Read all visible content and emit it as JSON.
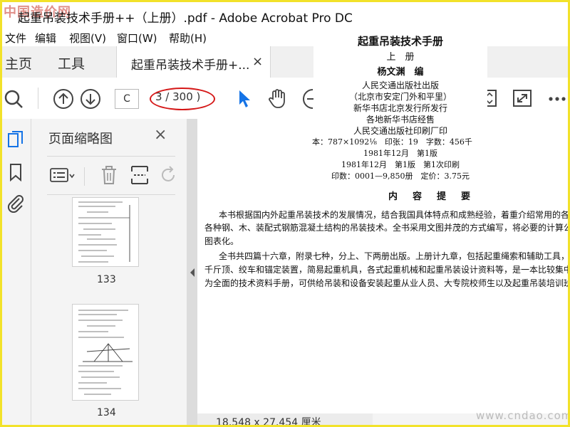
{
  "window": {
    "title": "起重吊装技术手册++（上册）.pdf - Adobe Acrobat Pro DC",
    "watermark_top": "中国造价网",
    "watermark_bottom": "www.cndao.com"
  },
  "menu": [
    "文件",
    "编辑",
    "视图(V)",
    "窗口(W)",
    "帮助(H)"
  ],
  "tabs": {
    "home": "主页",
    "tools": "工具",
    "document": "起重吊装技术手册+...",
    "close": "×"
  },
  "toolbar": {
    "page_input": "C",
    "page_count": "3 / 300 )"
  },
  "panel": {
    "title": "页面缩略图",
    "close": "×",
    "thumbnails": [
      {
        "number": "133"
      },
      {
        "number": "134"
      }
    ]
  },
  "document": {
    "header_lines": [
      "起重吊装技术手册",
      "上　册",
      "杨文渊　编",
      "人民交通出版社出版",
      "（北京市安定门外和平里）",
      "新华书店北京发行所发行",
      "各地新华书店经售",
      "人民交通出版社印刷厂印",
      "本：787×1092⅛　印张：19　字数：456千",
      "1981年12月　第1版",
      "1981年12月　第1版　第1次印刷",
      "印数：0001—9,850册　定价：3.75元"
    ],
    "section_title": "内　容　提　要",
    "body_lines": [
      "本书根据国内外起重吊装技术的发展情况，结合我国具体特点和成熟经验，着重介绍常用的各种",
      "各种钢、木、装配式钢筋混凝土结构的吊装技术。全书采用文图并茂的方式编写，将必要的计算公式",
      "图表化。",
      "全书共四篇十六章，附录七种，分上、下两册出版。上册计九章，包括起重绳索和辅助工具，滑车",
      "千斤顶、绞车和锚定装置，简易起重机具，各式起重机械和起重吊装设计资料等，是一本比较集中、",
      "为全面的技术资料手册，可供给吊装和设备安装起重从业人员、大专院校师生以及起重吊装培训班"
    ]
  },
  "status": {
    "dimensions": "18.548 x 27.454 厘米"
  },
  "colors": {
    "accent_blue": "#1473e6",
    "annotation_red": "#d51818",
    "frame_yellow": "#f2e22a"
  }
}
